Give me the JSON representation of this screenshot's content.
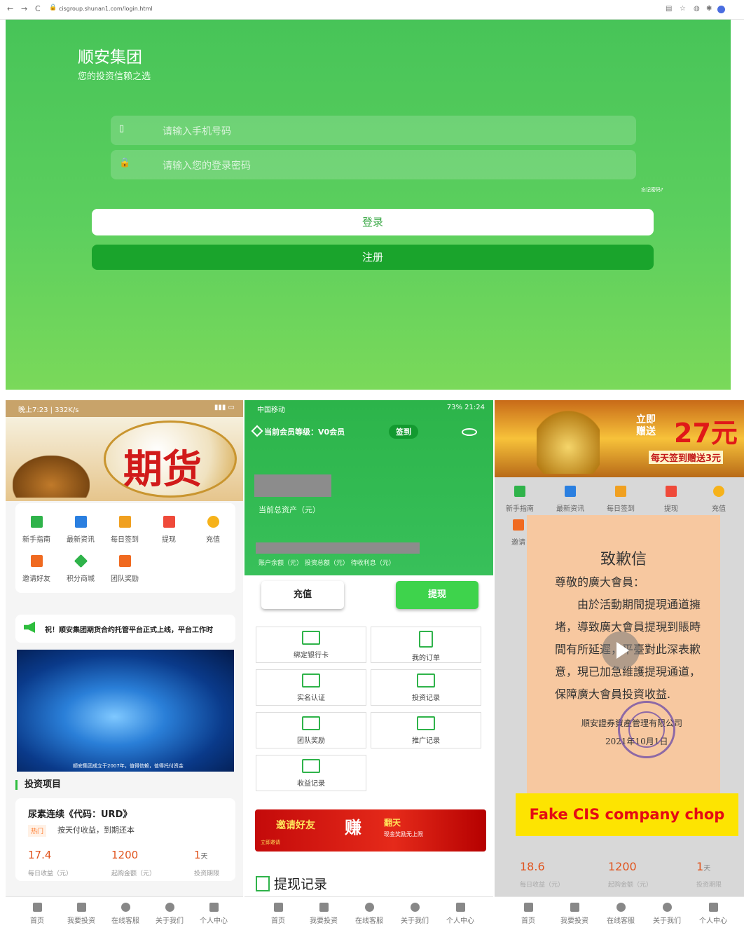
{
  "browser": {
    "url": "cisgroup.shunan1.com/login.html",
    "back": "←",
    "forward": "→",
    "reload": "C"
  },
  "login": {
    "brand": "顺安集团",
    "slogan": "您的投资信赖之选",
    "phone_placeholder": "请输入手机号码",
    "password_placeholder": "请输入您的登录密码",
    "forgot": "忘记密码?",
    "login_btn": "登录",
    "register_btn": "注册"
  },
  "p1": {
    "status_left": "晚上7:23 | 332K/s",
    "banner_text": "期货",
    "grid": [
      "新手指南",
      "最新资讯",
      "每日签到",
      "提现",
      "充值",
      "邀请好友",
      "积分商城",
      "团队奖励"
    ],
    "notice": "祝！顺安集团期货合约托管平台正式上线，平台工作时",
    "video_caption": "顺安集团成立于2007年，值得信赖，值得托付资金",
    "section": "投资项目",
    "product_name": "尿素连续《代码：URD》",
    "tag": "热门",
    "desc": "按天付收益，到期还本",
    "v1": "17.4",
    "l1": "每日收益（元）",
    "v2": "1200",
    "l2": "起购金额（元）",
    "v3": "1",
    "v3u": "天",
    "l3": "投资期限",
    "tabs": [
      "首页",
      "我要投资",
      "在线客服",
      "关于我们",
      "个人中心"
    ]
  },
  "p2": {
    "status_left": "中国移动",
    "status_right": "73% 21:24",
    "level": "当前会员等级：V0会员",
    "sign": "签到",
    "total": "当前总资产（元）",
    "sub": "账户余额（元）   投资总额（元）   待收利息（元）",
    "recharge": "充值",
    "withdraw": "提现",
    "menu": [
      "绑定银行卡",
      "我的订单",
      "实名认证",
      "投资记录",
      "团队奖励",
      "推广记录",
      "收益记录"
    ],
    "invite1": "邀请好友",
    "invite2": "赚",
    "invite3": "翻天",
    "invite4": "现金奖励无上限",
    "invite5": "立即邀请",
    "withdraw_record": "提现记录",
    "tabs": [
      "首页",
      "我要投资",
      "在线客服",
      "关于我们",
      "个人中心"
    ]
  },
  "p3": {
    "banner1": "立即\n赠送",
    "banner2": "27元",
    "banner3": "每天签到赠送3元",
    "grid": [
      "新手指南",
      "最新资讯",
      "每日签到",
      "提现",
      "充值",
      "邀请"
    ],
    "letter_title": "致歉信",
    "salutation": "尊敬的廣大會員：",
    "letter_body": "由於活動期間提現通道擁堵，導致廣大會員提現到賬時間有所延遲，平臺對此深表歉意，現已加急維護提現通道，保障廣大會員投資收益.",
    "company": "順安證券資產管理有限公司",
    "date": "2021年10月1日",
    "fake_label": "Fake CIS company chop",
    "v1": "18.6",
    "l1": "每日收益（元）",
    "v2": "1200",
    "l2": "起购金额（元）",
    "v3": "1",
    "v3u": "天",
    "l3": "投资期限",
    "tabs": [
      "首页",
      "我要投资",
      "在线客服",
      "关于我们",
      "个人中心"
    ]
  }
}
